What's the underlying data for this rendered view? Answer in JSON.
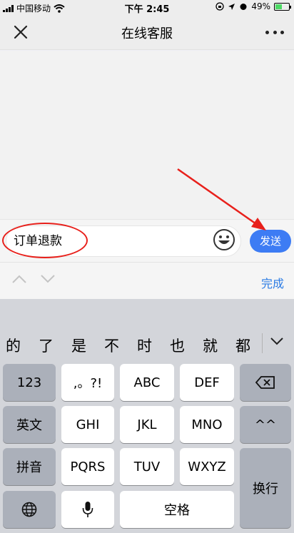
{
  "status": {
    "carrier": "中国移动",
    "time": "下午 2:45",
    "battery": "49%",
    "battery_level": 0.49
  },
  "nav": {
    "title": "在线客服"
  },
  "input": {
    "value": "订单退款",
    "send_label": "发送"
  },
  "toolbar": {
    "done_label": "完成"
  },
  "candidates": [
    "的",
    "了",
    "是",
    "不",
    "时",
    "也",
    "就",
    "都"
  ],
  "keyboard": {
    "row1": [
      "123",
      ",。?!",
      "ABC",
      "DEF"
    ],
    "row2": [
      "英文",
      "GHI",
      "JKL",
      "MNO",
      "^^"
    ],
    "row3": [
      "拼音",
      "PQRS",
      "TUV",
      "WXYZ"
    ],
    "enter_label": "换行",
    "space_label": "空格"
  },
  "colors": {
    "accent": "#3d7cf4",
    "annotation": "#e8201b"
  }
}
